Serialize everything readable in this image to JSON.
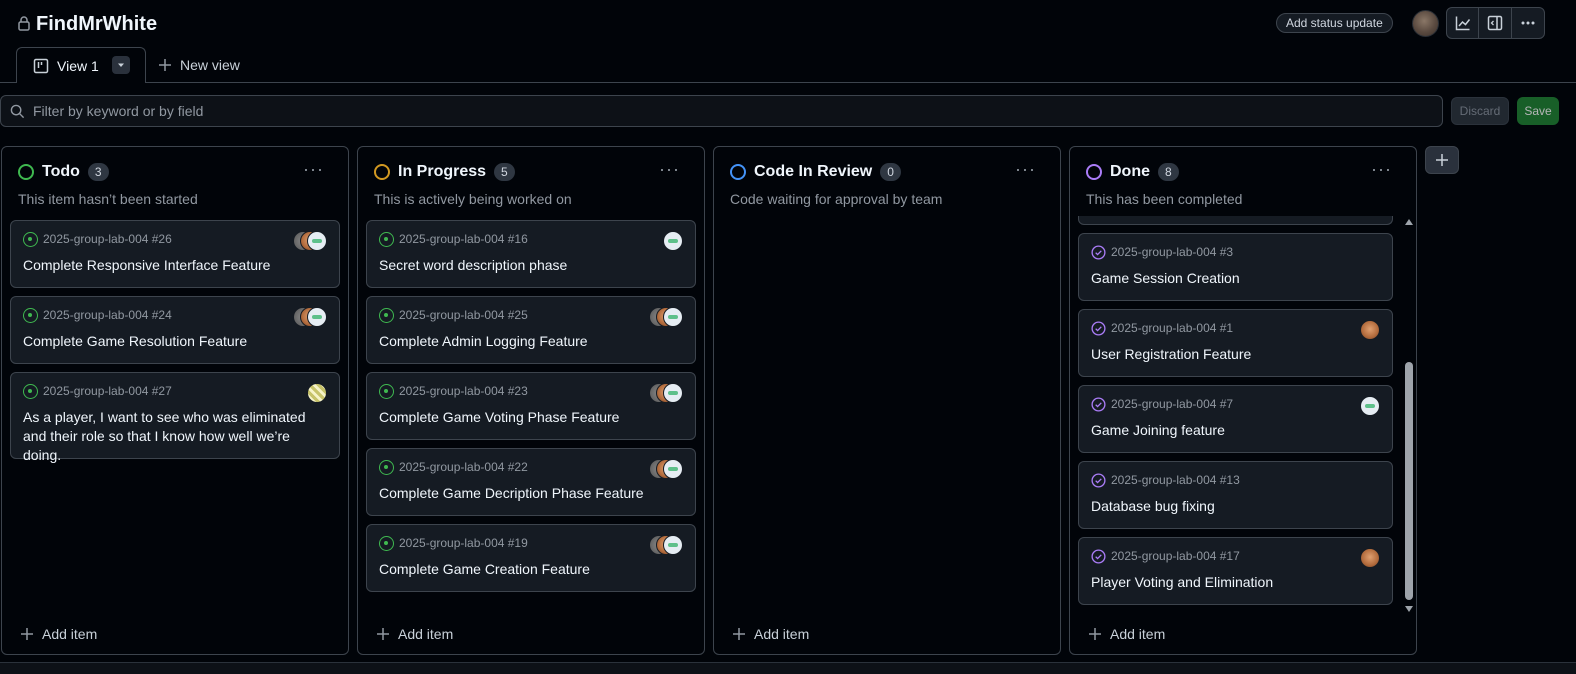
{
  "project": {
    "title": "FindMrWhite"
  },
  "header": {
    "status_update": "Add status update"
  },
  "tabs": {
    "view1": "View 1",
    "new_view": "New view"
  },
  "filter": {
    "placeholder": "Filter by keyword or by field",
    "discard": "Discard",
    "save": "Save"
  },
  "columns": [
    {
      "title": "Todo",
      "count": "3",
      "desc": "This item hasn’t been started",
      "color": "#3fb950",
      "add": "Add item",
      "cards": [
        {
          "ref": "2025-group-lab-004 #26",
          "title": "Complete Responsive Interface Feature"
        },
        {
          "ref": "2025-group-lab-004 #24",
          "title": "Complete Game Resolution Feature"
        },
        {
          "ref": "2025-group-lab-004 #27",
          "title": "As a player, I want to see who was eliminated and their role so that I know how well we’re doing."
        }
      ]
    },
    {
      "title": "In Progress",
      "count": "5",
      "desc": "This is actively being worked on",
      "color": "#d29922",
      "add": "Add item",
      "cards": [
        {
          "ref": "2025-group-lab-004 #16",
          "title": "Secret word description phase"
        },
        {
          "ref": "2025-group-lab-004 #25",
          "title": "Complete Admin Logging Feature"
        },
        {
          "ref": "2025-group-lab-004 #23",
          "title": "Complete Game Voting Phase Feature"
        },
        {
          "ref": "2025-group-lab-004 #22",
          "title": "Complete Game Decription Phase Feature"
        },
        {
          "ref": "2025-group-lab-004 #19",
          "title": "Complete Game Creation Feature"
        }
      ]
    },
    {
      "title": "Code In Review",
      "count": "0",
      "desc": "Code waiting for approval by team",
      "color": "#4493f8",
      "add": "Add item",
      "cards": []
    },
    {
      "title": "Done",
      "count": "8",
      "desc": "This has been completed",
      "color": "#ab7df8",
      "add": "Add item",
      "cards": [
        {
          "ref": "2025-group-lab-004 #3",
          "title": "Game Session Creation"
        },
        {
          "ref": "2025-group-lab-004 #1",
          "title": "User Registration Feature"
        },
        {
          "ref": "2025-group-lab-004 #7",
          "title": "Game Joining feature"
        },
        {
          "ref": "2025-group-lab-004 #13",
          "title": "Database bug fixing"
        },
        {
          "ref": "2025-group-lab-004 #17",
          "title": "Player Voting and Elimination"
        }
      ]
    }
  ]
}
